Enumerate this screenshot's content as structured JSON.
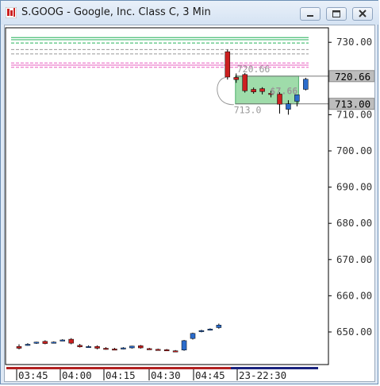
{
  "window": {
    "title": "S.GOOG - Google, Inc. Class C, 3 Min",
    "minimize_icon": "minimize-icon",
    "maximize_icon": "maximize-icon",
    "close_icon": "close-icon"
  },
  "price_axis": {
    "ticks": [
      "730.00",
      "720.00",
      "710.00",
      "700.00",
      "690.00",
      "680.00",
      "670.00",
      "660.00",
      "650.00"
    ],
    "tick_values": [
      730,
      720,
      710,
      700,
      690,
      680,
      670,
      660,
      650
    ],
    "ylim": [
      641,
      734
    ]
  },
  "price_tags": {
    "last": "720.66",
    "prev": "713.00"
  },
  "overlays": {
    "upper_ghost": "720.66",
    "lower_ghost": "713.0",
    "box_label": "$7.66"
  },
  "time_axis": {
    "labels": [
      "03:45",
      "04:00",
      "04:15",
      "04:30",
      "04:45",
      "23-22:30"
    ]
  },
  "chart_data": {
    "type": "candlestick",
    "title": "S.GOOG - Google, Inc. Class C, 3 Min",
    "candles": [
      {
        "o": 646.0,
        "h": 646.6,
        "l": 645.2,
        "c": 645.5
      },
      {
        "o": 646.5,
        "h": 646.9,
        "l": 646.2,
        "c": 646.6
      },
      {
        "o": 647.0,
        "h": 647.3,
        "l": 646.7,
        "c": 647.2
      },
      {
        "o": 647.4,
        "h": 647.7,
        "l": 646.6,
        "c": 646.8
      },
      {
        "o": 647.0,
        "h": 647.4,
        "l": 646.8,
        "c": 647.2
      },
      {
        "o": 647.7,
        "h": 648.0,
        "l": 647.5,
        "c": 647.8
      },
      {
        "o": 648.0,
        "h": 648.3,
        "l": 646.6,
        "c": 646.9
      },
      {
        "o": 646.3,
        "h": 646.7,
        "l": 645.7,
        "c": 645.9
      },
      {
        "o": 645.9,
        "h": 646.3,
        "l": 645.6,
        "c": 646.0
      },
      {
        "o": 646.0,
        "h": 646.3,
        "l": 645.2,
        "c": 645.5
      },
      {
        "o": 645.5,
        "h": 645.8,
        "l": 645.1,
        "c": 645.4
      },
      {
        "o": 645.3,
        "h": 645.6,
        "l": 645.0,
        "c": 645.2
      },
      {
        "o": 645.4,
        "h": 645.8,
        "l": 645.2,
        "c": 645.6
      },
      {
        "o": 645.6,
        "h": 646.2,
        "l": 645.4,
        "c": 646.1
      },
      {
        "o": 646.2,
        "h": 646.4,
        "l": 645.4,
        "c": 645.6
      },
      {
        "o": 645.4,
        "h": 645.6,
        "l": 645.1,
        "c": 645.2
      },
      {
        "o": 645.2,
        "h": 645.4,
        "l": 645.0,
        "c": 645.1
      },
      {
        "o": 645.1,
        "h": 645.3,
        "l": 644.8,
        "c": 644.9
      },
      {
        "o": 644.8,
        "h": 645.0,
        "l": 644.5,
        "c": 644.7
      },
      {
        "o": 645.0,
        "h": 647.8,
        "l": 644.8,
        "c": 647.6
      },
      {
        "o": 648.2,
        "h": 649.8,
        "l": 647.9,
        "c": 649.6
      },
      {
        "o": 650.2,
        "h": 650.6,
        "l": 649.9,
        "c": 650.4
      },
      {
        "o": 650.6,
        "h": 651.0,
        "l": 650.4,
        "c": 650.8
      },
      {
        "o": 651.2,
        "h": 652.3,
        "l": 650.9,
        "c": 651.9
      },
      {
        "o": 727.4,
        "h": 728.0,
        "l": 719.7,
        "c": 720.4
      },
      {
        "o": 720.3,
        "h": 721.4,
        "l": 718.8,
        "c": 719.7
      },
      {
        "o": 721.1,
        "h": 721.5,
        "l": 716.1,
        "c": 716.6
      },
      {
        "o": 717.0,
        "h": 717.5,
        "l": 715.8,
        "c": 716.3
      },
      {
        "o": 717.2,
        "h": 717.6,
        "l": 715.6,
        "c": 716.4
      },
      {
        "o": 715.9,
        "h": 716.6,
        "l": 714.8,
        "c": 715.7
      },
      {
        "o": 715.7,
        "h": 716.2,
        "l": 710.3,
        "c": 712.9
      },
      {
        "o": 711.5,
        "h": 714.0,
        "l": 710.0,
        "c": 713.0
      },
      {
        "o": 713.7,
        "h": 715.5,
        "l": 712.3,
        "c": 715.5
      },
      {
        "o": 717.0,
        "h": 720.2,
        "l": 716.7,
        "c": 719.8
      }
    ],
    "reference_lines": [
      {
        "value": 731.3,
        "color": "#26b25a",
        "style": "solid"
      },
      {
        "value": 730.7,
        "color": "#26b25a",
        "style": "solid"
      },
      {
        "value": 729.8,
        "color": "#26b25a",
        "style": "dashed"
      },
      {
        "value": 728.0,
        "color": "#999999",
        "style": "dashed"
      },
      {
        "value": 726.8,
        "color": "#999999",
        "style": "dashed"
      },
      {
        "value": 724.3,
        "color": "#e75fbf",
        "style": "dashed"
      },
      {
        "value": 723.7,
        "color": "#e75fbf",
        "style": "solid"
      },
      {
        "value": 723.1,
        "color": "#e75fbf",
        "style": "dashed"
      }
    ],
    "colors": {
      "up": "#2b6ccc",
      "down": "#cc2020",
      "grid": "#cccccc",
      "highlight": "#7fd08e"
    }
  }
}
